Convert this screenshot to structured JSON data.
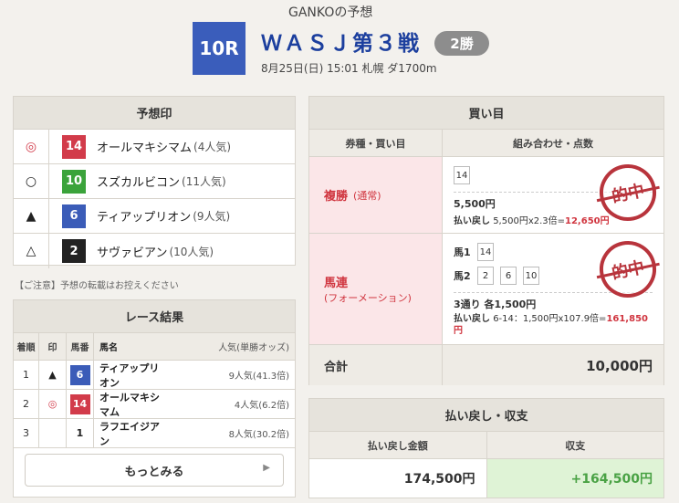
{
  "header": {
    "predictor": "GANKOの予想",
    "race_number": "10R",
    "race_name": "ＷＡＳＪ第３戦",
    "race_class": "2勝",
    "race_info": "8月25日(日) 15:01 札幌 ダ1700m"
  },
  "predictions": {
    "title": "予想印",
    "items": [
      {
        "mark": "◎",
        "number": "14",
        "color": "#d23b4a",
        "name": "オールマキシマム",
        "popularity": "(4人気)"
      },
      {
        "mark": "○",
        "number": "10",
        "color": "#3ba33b",
        "name": "スズカルビコン",
        "popularity": "(11人気)"
      },
      {
        "mark": "▲",
        "number": "6",
        "color": "#3b5cb8",
        "name": "ティアップリオン",
        "popularity": "(9人気)"
      },
      {
        "mark": "△",
        "number": "2",
        "color": "#222222",
        "name": "サヴァビアン",
        "popularity": "(10人気)"
      }
    ],
    "notice": "【ご注意】予想の転載はお控えください"
  },
  "results": {
    "title": "レース結果",
    "headers": {
      "rank": "着順",
      "mark": "印",
      "number": "馬番",
      "name": "馬名",
      "odds": "人気(単勝オッズ)"
    },
    "rows": [
      {
        "rank": "1",
        "mark": "▲",
        "number": "6",
        "color": "#3b5cb8",
        "name": "ティアップリオン",
        "odds": "9人気(41.3倍)"
      },
      {
        "rank": "2",
        "mark": "◎",
        "number": "14",
        "color": "#d23b4a",
        "name": "オールマキシマム",
        "odds": "4人気(6.2倍)"
      },
      {
        "rank": "3",
        "mark": "",
        "number": "1",
        "color": "#ffffff",
        "name": "ラフエイジアン",
        "odds": "8人気(30.2倍)"
      }
    ],
    "more_label": "もっとみる"
  },
  "bets": {
    "title": "買い目",
    "headers": {
      "type": "券種・買い目",
      "combo": "組み合わせ・点数"
    },
    "items": [
      {
        "type": "複勝",
        "subtype": "(通常)",
        "picks": [
          "14"
        ],
        "amount": "5,500円",
        "payout_label": "払い戻し",
        "payout_calc": "5,500円x2.3倍=",
        "payout_total": "12,650円",
        "stamp": "的中"
      },
      {
        "type": "馬連",
        "subtype": "(フォーメーション)",
        "axis1_label": "馬1",
        "axis1": [
          "14"
        ],
        "axis2_label": "馬2",
        "axis2": [
          "2",
          "6",
          "10"
        ],
        "amount": "3通り 各1,500円",
        "payout_label": "払い戻し",
        "payout_calc": "6-14：1,500円x107.9倍=",
        "payout_total": "161,850円",
        "stamp": "的中"
      }
    ],
    "total_label": "合計",
    "total_value": "10,000円"
  },
  "payout": {
    "title": "払い戻し・収支",
    "payout_header": "払い戻し金額",
    "balance_header": "収支",
    "payout_value": "174,500円",
    "balance_value": "+164,500円"
  }
}
